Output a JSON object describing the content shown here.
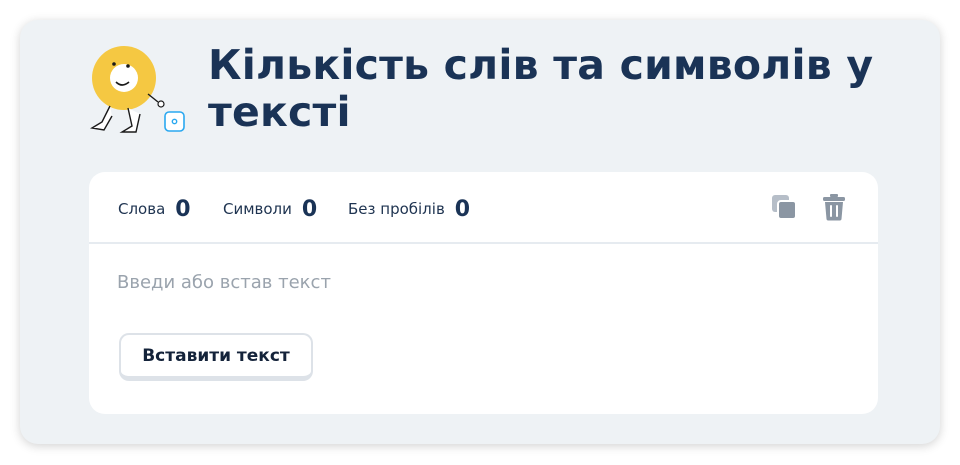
{
  "header": {
    "title": "Кількість слів та символів у тексті",
    "mascot_icon": "ring-character-with-die-icon"
  },
  "stats": [
    {
      "label": "Слова",
      "value": "0"
    },
    {
      "label": "Символи",
      "value": "0"
    },
    {
      "label": "Без пробілів",
      "value": "0"
    }
  ],
  "toolbar": {
    "copy_icon": "copy-icon",
    "delete_icon": "trash-icon"
  },
  "editor": {
    "value": "",
    "placeholder": "Введи або встав текст"
  },
  "paste_button": {
    "label": "Вставити текст"
  },
  "colors": {
    "title": "#1a3356",
    "background": "#eef2f5",
    "accent_yellow": "#f5c842",
    "icon_gray": "#8b96a3"
  }
}
